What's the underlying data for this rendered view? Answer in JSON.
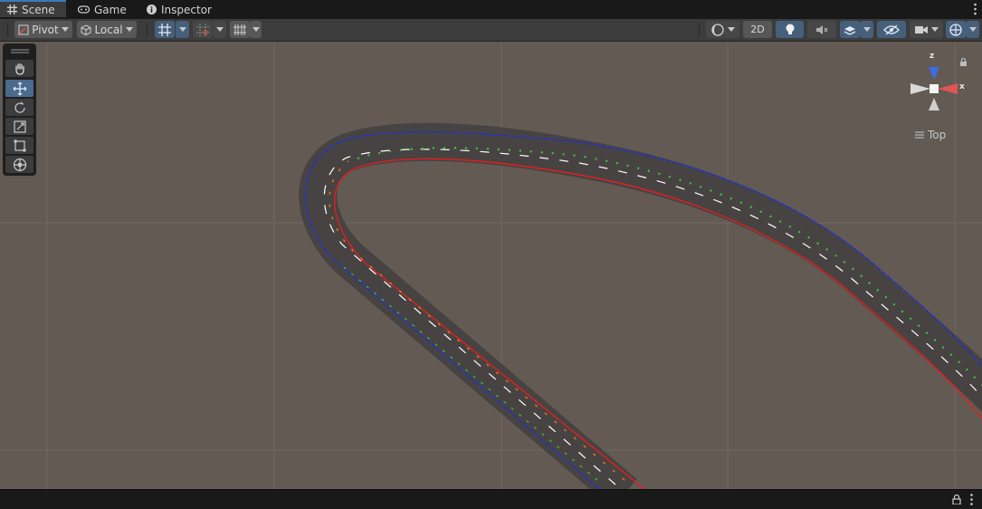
{
  "tabs": [
    {
      "label": "Scene",
      "icon": "grid-icon",
      "active": true
    },
    {
      "label": "Game",
      "icon": "gamepad-icon",
      "active": false
    },
    {
      "label": "Inspector",
      "icon": "info-icon",
      "active": false
    }
  ],
  "toolbar": {
    "pivot_label": "Pivot",
    "local_label": "Local",
    "mode_2d_label": "2D"
  },
  "tools": [
    {
      "name": "hand-tool",
      "icon": "hand-icon"
    },
    {
      "name": "move-tool",
      "icon": "move-arrows-icon",
      "selected": true
    },
    {
      "name": "rotate-tool",
      "icon": "rotate-icon"
    },
    {
      "name": "scale-tool",
      "icon": "scale-icon"
    },
    {
      "name": "rect-tool",
      "icon": "rect-transform-icon"
    },
    {
      "name": "transform-tool",
      "icon": "transform-icon"
    }
  ],
  "gizmo": {
    "axis_z_label": "z",
    "axis_x_label": "x",
    "view_label": "Top"
  },
  "colors": {
    "accent": "#3a79bb",
    "viewport_bg": "#625a53",
    "road": "#474342",
    "left_edge": "#1a2fe6",
    "right_edge": "#e21f1f",
    "lane_green": "#3fc23f",
    "lane_orange": "#e0701e"
  }
}
